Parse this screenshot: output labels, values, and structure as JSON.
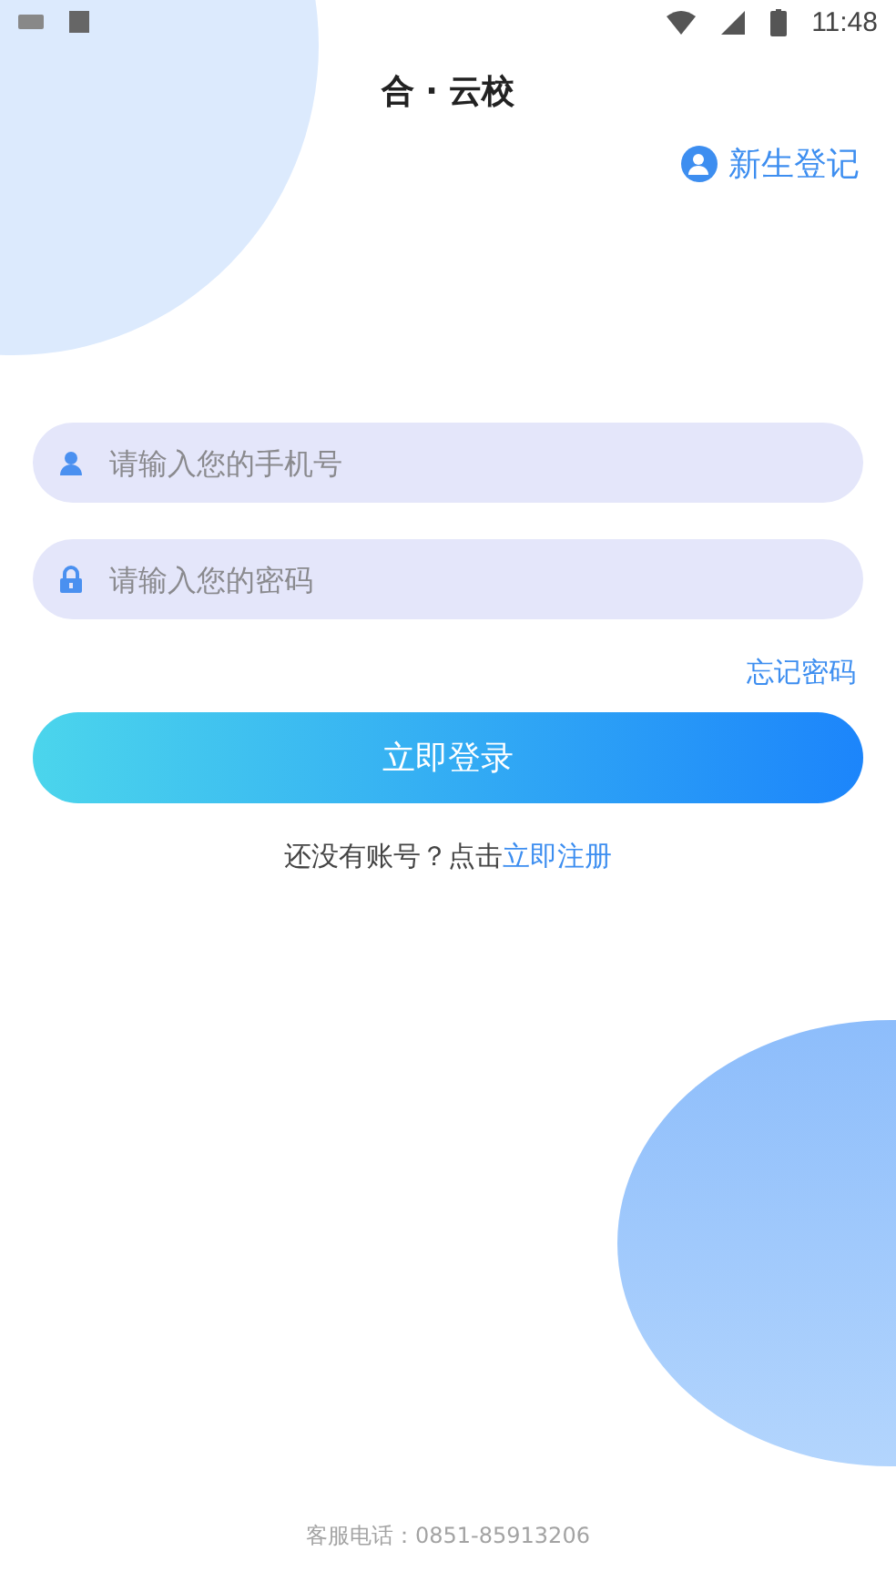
{
  "status_bar": {
    "time": "11:48"
  },
  "title": "合 · 云校",
  "register_link": "新生登记",
  "fields": [
    {
      "kind": "phone",
      "placeholder": "请输入您的手机号"
    },
    {
      "kind": "password",
      "placeholder": "请输入您的密码"
    }
  ],
  "forgot_password": "忘记密码",
  "login_button": "立即登录",
  "signup_prompt": {
    "text": "还没有账号？点击",
    "link": "立即注册"
  },
  "footer": "客服电话：0851-85913206"
}
